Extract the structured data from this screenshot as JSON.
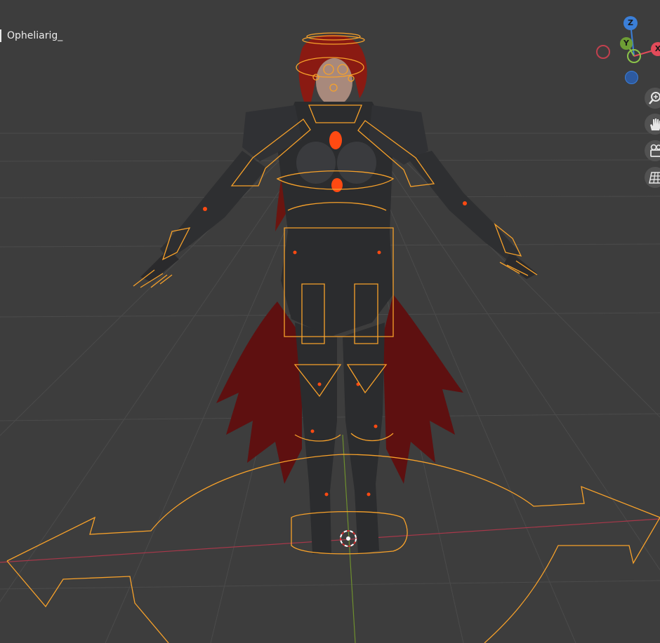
{
  "viewport": {
    "object_name": "Opheliarig_"
  },
  "gizmo": {
    "x_label": "X",
    "y_label": "Y",
    "z_label": "Z",
    "x_color": "#e34b5a",
    "y_color": "#8bc34a",
    "z_color": "#3b7fd8"
  },
  "nav_tools": [
    {
      "icon": "zoom-icon"
    },
    {
      "icon": "hand-pan-icon"
    },
    {
      "icon": "camera-icon"
    },
    {
      "icon": "grid-ortho-icon"
    }
  ],
  "colors": {
    "background": "#3d3d3d",
    "grid": "#4a4a4a",
    "rig": "#f7a12a",
    "x_axis_line": "#b23a48",
    "y_axis_line": "#6b8f2a"
  }
}
